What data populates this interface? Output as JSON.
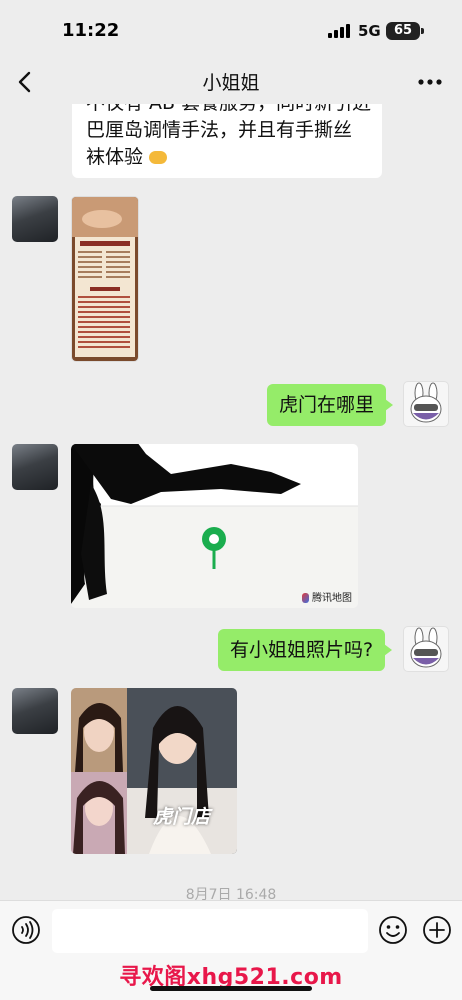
{
  "status": {
    "time": "11:22",
    "network": "5G",
    "battery": "65"
  },
  "nav": {
    "title": "小姐姐"
  },
  "messages": {
    "partial_top": {
      "line1": "不仅有 AB 套餐服务，同时新引进",
      "line2": "巴厘岛调情手法，并且有手撕丝",
      "line3": "袜体验"
    },
    "out1": "虎门在哪里",
    "out2": "有小姐姐照片吗?",
    "map_provider": "腾讯地图",
    "photo_caption": "虎门店"
  },
  "timestamp": "8月7日 16:48",
  "watermark": "寻欢阁xhg521.com",
  "colors": {
    "accent": "#95ec69",
    "background": "#ededed",
    "map_pin": "#1aad4e",
    "watermark": "#e8174a"
  }
}
